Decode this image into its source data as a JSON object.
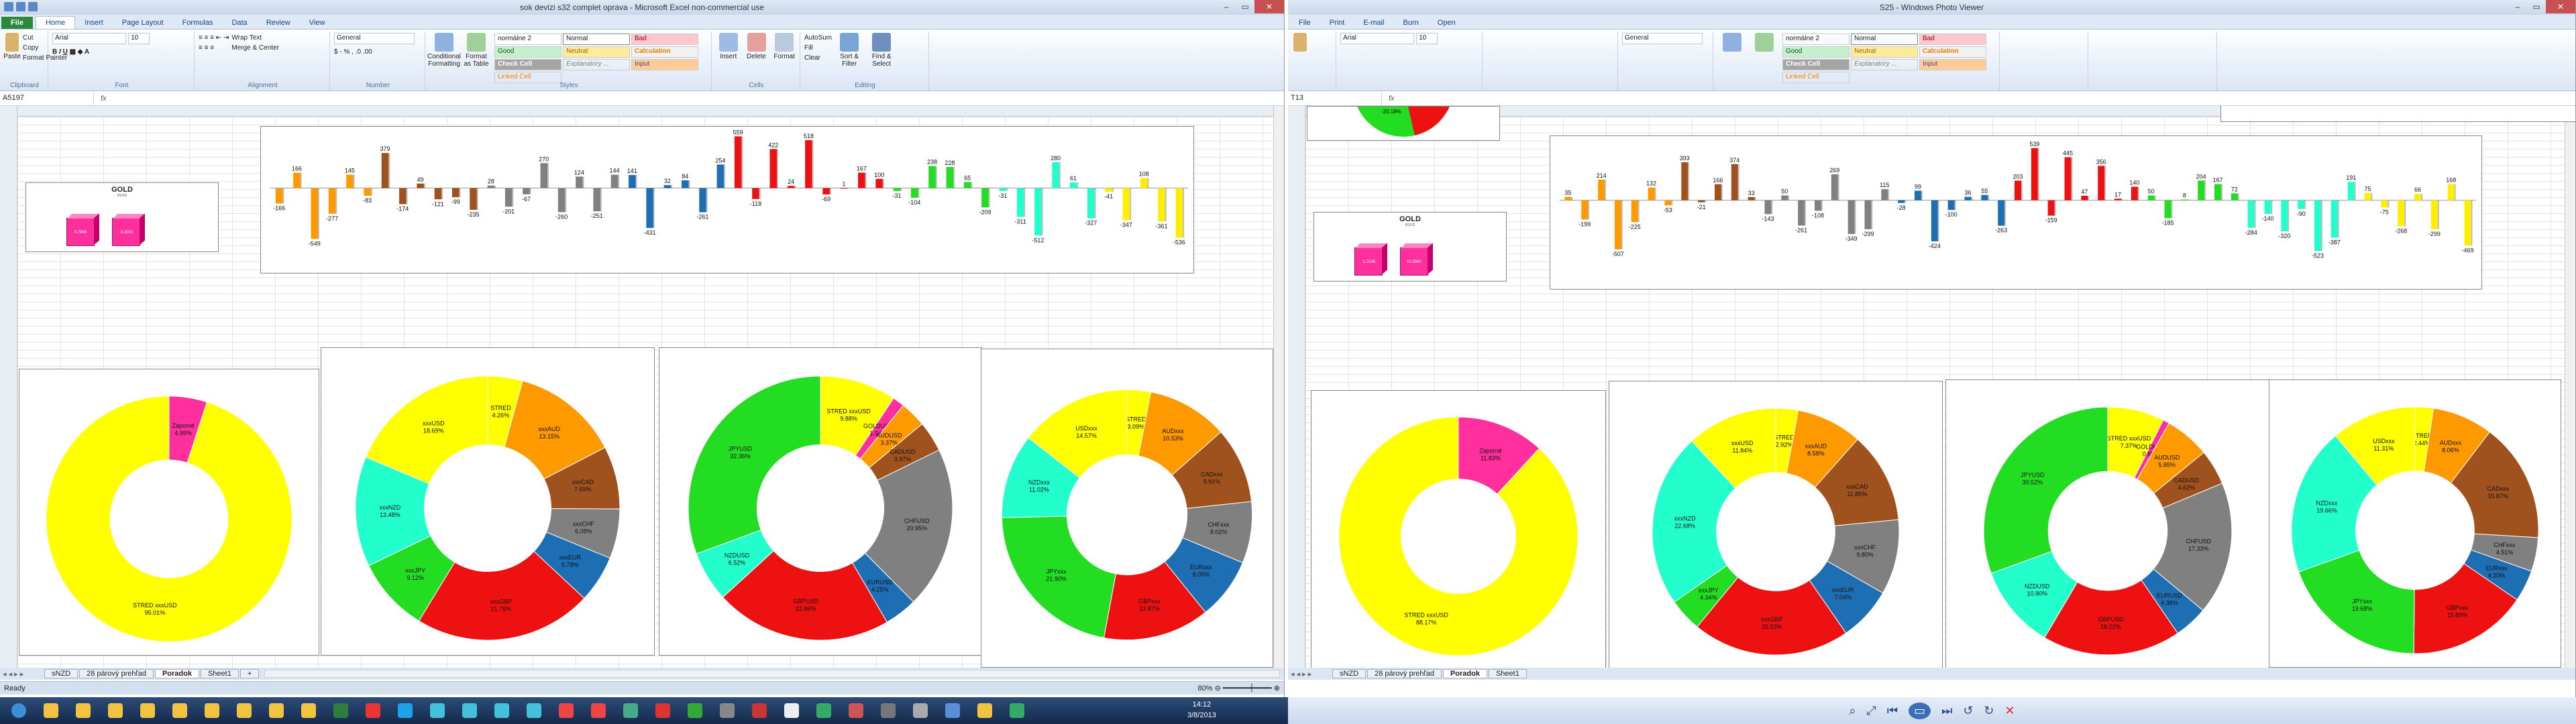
{
  "left": {
    "title": "sok devizi s32 complet oprava - Microsoft Excel non-commercial use",
    "tabs": [
      "File",
      "Home",
      "Insert",
      "Page Layout",
      "Formulas",
      "Data",
      "Review",
      "View"
    ],
    "clipboard": {
      "paste": "Paste",
      "cut": "Cut",
      "copy": "Copy",
      "format_painter": "Format Painter",
      "label": "Clipboard"
    },
    "font": {
      "name": "Arial",
      "size": "10",
      "label": "Font"
    },
    "alignment": {
      "wrap": "Wrap Text",
      "merge": "Merge & Center",
      "label": "Alignment"
    },
    "number": {
      "format": "General",
      "label": "Number"
    },
    "styles": {
      "cond": "Conditional Formatting",
      "table": "Format as Table",
      "label": "Styles",
      "boxes": [
        "normálne 2",
        "Normal",
        "Bad",
        "Good",
        "Neutral",
        "Calculation",
        "Check Cell",
        "Explanatory ...",
        "Input",
        "Linked Cell"
      ]
    },
    "cells": {
      "insert": "Insert",
      "delete": "Delete",
      "format": "Format",
      "label": "Cells"
    },
    "editing": {
      "autosum": "AutoSum",
      "fill": "Fill",
      "clear": "Clear",
      "sort": "Sort & Filter",
      "find": "Find & Select",
      "label": "Editing"
    },
    "namebox": "A5197",
    "sheets": [
      "sNZD",
      "28 párový prehľad",
      "Poradok",
      "Sheet1"
    ],
    "active_sheet": "Poradok",
    "status": "Ready",
    "zoom": "80%",
    "gold": {
      "title": "GOLD",
      "sub": "RSI1D",
      "values": [
        "0.7966",
        "-0.3003"
      ]
    },
    "bars": {
      "values": [
        -166,
        166,
        -549,
        -277,
        145,
        -83,
        379,
        -174,
        49,
        -121,
        -99,
        -235,
        28,
        -201,
        -67,
        270,
        -260,
        124,
        -251,
        144,
        141,
        -431,
        32,
        84,
        -261,
        254,
        559,
        -118,
        422,
        24,
        518,
        -69,
        1,
        167,
        100,
        -31,
        -104,
        238,
        228,
        65,
        -209,
        -31,
        -311,
        -512,
        280,
        61,
        -327,
        -41,
        -347,
        108,
        -361,
        -536
      ],
      "colors": [
        "#ff9900",
        "#ff9900",
        "#ff9900",
        "#ff9900",
        "#ff9900",
        "#ff9900",
        "#a0521e",
        "#a0521e",
        "#a0521e",
        "#a0521e",
        "#a0521e",
        "#a0521e",
        "#808080",
        "#808080",
        "#808080",
        "#808080",
        "#808080",
        "#808080",
        "#808080",
        "#808080",
        "#1e6eb4",
        "#1e6eb4",
        "#1e6eb4",
        "#1e6eb4",
        "#1e6eb4",
        "#1e6eb4",
        "#ee1111",
        "#ee1111",
        "#ee1111",
        "#ee1111",
        "#ee1111",
        "#ee1111",
        "#ee1111",
        "#ee1111",
        "#ee1111",
        "#22dd22",
        "#22dd22",
        "#22dd22",
        "#22dd22",
        "#22dd22",
        "#22dd22",
        "#22ffcc",
        "#22ffcc",
        "#22ffcc",
        "#22ffcc",
        "#22ffcc",
        "#22ffcc",
        "#ffee00",
        "#ffee00",
        "#ffee00",
        "#ffee00",
        "#ffee00"
      ]
    },
    "donuts": [
      {
        "slices": [
          {
            "label": "Záporné",
            "pct": "4.99%",
            "v": 4.99,
            "c": "#ff2f9d"
          },
          {
            "label": "STRED xxxUSD",
            "pct": "95.01%",
            "v": 95.01,
            "c": "#ffff00"
          }
        ]
      },
      {
        "slices": [
          {
            "label": "STRED",
            "pct": "4.26%",
            "v": 4.26,
            "c": "#ffff00"
          },
          {
            "label": "xxxAUD",
            "pct": "13.15%",
            "v": 13.15,
            "c": "#ff9900"
          },
          {
            "label": "xxxCAD",
            "pct": "7.69%",
            "v": 7.69,
            "c": "#a0521e"
          },
          {
            "label": "xxxCHF",
            "pct": "6.08%",
            "v": 6.08,
            "c": "#808080"
          },
          {
            "label": "xxxEUR",
            "pct": "5.78%",
            "v": 5.78,
            "c": "#1e6eb4"
          },
          {
            "label": "xxxGBP",
            "pct": "21.75%",
            "v": 21.75,
            "c": "#ee1111"
          },
          {
            "label": "xxxJPY",
            "pct": "9.12%",
            "v": 9.12,
            "c": "#22dd22"
          },
          {
            "label": "xxxNZD",
            "pct": "13.48%",
            "v": 13.48,
            "c": "#22ffcc"
          },
          {
            "label": "xxxUSD",
            "pct": "18.69%",
            "v": 18.69,
            "c": "#ffff00"
          }
        ]
      },
      {
        "slices": [
          {
            "label": "STRED xxxUSD",
            "pct": "9.88%",
            "v": 9.88,
            "c": "#ffff00"
          },
          {
            "label": "GOLDUSD",
            "pct": "1.54%",
            "v": 1.54,
            "c": "#ff2f9d"
          },
          {
            "label": "AUDUSD",
            "pct": "3.37%",
            "v": 3.37,
            "c": "#ff9900"
          },
          {
            "label": "CADUSD",
            "pct": "3.97%",
            "v": 3.97,
            "c": "#a0521e"
          },
          {
            "label": "CHFUSD",
            "pct": "20.95%",
            "v": 20.95,
            "c": "#808080"
          },
          {
            "label": "EURUSD",
            "pct": "4.25%",
            "v": 4.25,
            "c": "#1e6eb4"
          },
          {
            "label": "GBPUSD",
            "pct": "22.86%",
            "v": 22.86,
            "c": "#ee1111"
          },
          {
            "label": "NZDUSD",
            "pct": "6.52%",
            "v": 6.52,
            "c": "#22ffcc"
          },
          {
            "label": "JPYUSD",
            "pct": "32.36%",
            "v": 32.36,
            "c": "#22dd22"
          }
        ]
      },
      {
        "slices": [
          {
            "label": "STRED",
            "pct": "3.09%",
            "v": 3.09,
            "c": "#ffff00"
          },
          {
            "label": "AUDxxx",
            "pct": "10.53%",
            "v": 10.53,
            "c": "#ff9900"
          },
          {
            "label": "CADxxx",
            "pct": "9.91%",
            "v": 9.91,
            "c": "#a0521e"
          },
          {
            "label": "CHFxxx",
            "pct": "8.02%",
            "v": 8.02,
            "c": "#808080"
          },
          {
            "label": "EURxxx",
            "pct": "8.05%",
            "v": 8.05,
            "c": "#1e6eb4"
          },
          {
            "label": "GBPxxx",
            "pct": "13.87%",
            "v": 13.87,
            "c": "#ee1111"
          },
          {
            "label": "JPYxxx",
            "pct": "21.90%",
            "v": 21.9,
            "c": "#22dd22"
          },
          {
            "label": "NZDxxx",
            "pct": "11.02%",
            "v": 11.02,
            "c": "#22ffcc"
          },
          {
            "label": "USDxxx",
            "pct": "14.57%",
            "v": 14.57,
            "c": "#ffff00"
          }
        ]
      }
    ]
  },
  "right": {
    "title": "S25 - Windows Photo Viewer",
    "menu": [
      "File",
      "Print",
      "E-mail",
      "Burn",
      "Open"
    ],
    "namebox": "T13",
    "font": {
      "name": "Arial",
      "size": "10"
    },
    "number": {
      "format": "General"
    },
    "styles": {
      "boxes": [
        "normálne 2",
        "Normal",
        "Bad",
        "Good",
        "Neutral",
        "Calculation",
        "Check Cell",
        "Explanatory ...",
        "Input",
        "Linked Cell"
      ]
    },
    "sheets": [
      "sNZD",
      "28 párový prehľad",
      "Poradok",
      "Sheet1"
    ],
    "active_sheet": "Poradok",
    "top_pie_label": "-20.18%",
    "gold": {
      "title": "GOLD",
      "sub": "RSI1D",
      "values": [
        "-1.2166",
        "10.5960"
      ]
    },
    "bars": {
      "values": [
        35,
        -199,
        214,
        -507,
        -225,
        132,
        -53,
        393,
        -21,
        166,
        374,
        33,
        -143,
        50,
        -261,
        -108,
        269,
        -349,
        -299,
        115,
        -28,
        99,
        -424,
        -100,
        36,
        55,
        -263,
        203,
        539,
        -159,
        445,
        47,
        356,
        17,
        140,
        50,
        -185,
        8,
        204,
        167,
        72,
        -284,
        -140,
        -320,
        -90,
        -523,
        -387,
        191,
        75,
        -75,
        -268,
        66,
        -299,
        168,
        -469
      ],
      "colors": [
        "#ff9900",
        "#ff9900",
        "#ff9900",
        "#ff9900",
        "#ff9900",
        "#ff9900",
        "#ff9900",
        "#a0521e",
        "#a0521e",
        "#a0521e",
        "#a0521e",
        "#a0521e",
        "#808080",
        "#808080",
        "#808080",
        "#808080",
        "#808080",
        "#808080",
        "#808080",
        "#808080",
        "#1e6eb4",
        "#1e6eb4",
        "#1e6eb4",
        "#1e6eb4",
        "#1e6eb4",
        "#1e6eb4",
        "#1e6eb4",
        "#ee1111",
        "#ee1111",
        "#ee1111",
        "#ee1111",
        "#ee1111",
        "#ee1111",
        "#ee1111",
        "#ee1111",
        "#22dd22",
        "#22dd22",
        "#22dd22",
        "#22dd22",
        "#22dd22",
        "#22dd22",
        "#22ffcc",
        "#22ffcc",
        "#22ffcc",
        "#22ffcc",
        "#22ffcc",
        "#22ffcc",
        "#22ffcc",
        "#ffee00",
        "#ffee00",
        "#ffee00",
        "#ffee00",
        "#ffee00",
        "#ffee00",
        "#ffee00"
      ]
    },
    "donuts": [
      {
        "slices": [
          {
            "label": "Záporné",
            "pct": "11.83%",
            "v": 11.83,
            "c": "#ff2f9d"
          },
          {
            "label": "STRED xxxUSD",
            "pct": "88.17%",
            "v": 88.17,
            "c": "#ffff00"
          }
        ]
      },
      {
        "slices": [
          {
            "label": "STRED",
            "pct": "2.92%",
            "v": 2.92,
            "c": "#ffff00"
          },
          {
            "label": "xxxAUD",
            "pct": "8.58%",
            "v": 8.58,
            "c": "#ff9900"
          },
          {
            "label": "xxxCAD",
            "pct": "11.85%",
            "v": 11.85,
            "c": "#a0521e"
          },
          {
            "label": "xxxCHF",
            "pct": "9.80%",
            "v": 9.8,
            "c": "#808080"
          },
          {
            "label": "xxxEUR",
            "pct": "7.04%",
            "v": 7.04,
            "c": "#1e6eb4"
          },
          {
            "label": "xxxGBP",
            "pct": "20.53%",
            "v": 20.53,
            "c": "#ee1111"
          },
          {
            "label": "xxxJPY",
            "pct": "4.34%",
            "v": 4.34,
            "c": "#22dd22"
          },
          {
            "label": "xxxNZD",
            "pct": "22.68%",
            "v": 22.68,
            "c": "#22ffcc"
          },
          {
            "label": "xxxUSD",
            "pct": "11.84%",
            "v": 11.84,
            "c": "#ffff00"
          }
        ]
      },
      {
        "slices": [
          {
            "label": "STRED xxxUSD",
            "pct": "7.37%",
            "v": 7.37,
            "c": "#ffff00"
          },
          {
            "label": "GOLDUSD",
            "pct": "0.85%",
            "v": 0.85,
            "c": "#ff2f9d"
          },
          {
            "label": "AUDUSD",
            "pct": "5.85%",
            "v": 5.85,
            "c": "#ff9900"
          },
          {
            "label": "CADUSD",
            "pct": "4.62%",
            "v": 4.62,
            "c": "#a0521e"
          },
          {
            "label": "CHFUSD",
            "pct": "17.33%",
            "v": 17.33,
            "c": "#808080"
          },
          {
            "label": "EURUSD",
            "pct": "4.38%",
            "v": 4.38,
            "c": "#1e6eb4"
          },
          {
            "label": "GBPUSD",
            "pct": "18.02%",
            "v": 18.02,
            "c": "#ee1111"
          },
          {
            "label": "NZDUSD",
            "pct": "10.90%",
            "v": 10.9,
            "c": "#22ffcc"
          },
          {
            "label": "JPYUSD",
            "pct": "30.52%",
            "v": 30.52,
            "c": "#22dd22"
          }
        ]
      },
      {
        "slices": [
          {
            "label": "STRED",
            "pct": "2.44%",
            "v": 2.44,
            "c": "#ffff00"
          },
          {
            "label": "AUDxxx",
            "pct": "8.06%",
            "v": 8.06,
            "c": "#ff9900"
          },
          {
            "label": "CADxxx",
            "pct": "15.87%",
            "v": 15.87,
            "c": "#a0521e"
          },
          {
            "label": "CHFxxx",
            "pct": "4.51%",
            "v": 4.51,
            "c": "#808080"
          },
          {
            "label": "EURxxx",
            "pct": "4.20%",
            "v": 4.2,
            "c": "#1e6eb4"
          },
          {
            "label": "GBPxxx",
            "pct": "15.89%",
            "v": 15.89,
            "c": "#ee1111"
          },
          {
            "label": "JPYxxx",
            "pct": "19.68%",
            "v": 19.68,
            "c": "#22dd22"
          },
          {
            "label": "NZDxxx",
            "pct": "19.66%",
            "v": 19.66,
            "c": "#22ffcc"
          },
          {
            "label": "USDxxx",
            "pct": "11.31%",
            "v": 11.31,
            "c": "#ffff00"
          }
        ]
      }
    ]
  },
  "taskbar": {
    "time": "14:12",
    "date": "3/8/2013",
    "icons": [
      "#3b8fd6",
      "#f2c341",
      "#f2c341",
      "#f2c341",
      "#f2c341",
      "#f2c341",
      "#f2c341",
      "#f2c341",
      "#f2c341",
      "#f2c341",
      "#2f7d3e",
      "#e33",
      "#1aa3e8",
      "#44c0d8",
      "#44c0d8",
      "#44c0d8",
      "#44c0d8",
      "#e44",
      "#e44",
      "#4a8",
      "#d33",
      "#3a3",
      "#888",
      "#c33",
      "#eee",
      "#3a6",
      "#c55",
      "#777",
      "#aaa",
      "#5a8fd6",
      "#f2c341",
      "#3a6"
    ]
  },
  "photoviewer": {
    "controls": [
      "zoom",
      "actual-size",
      "prev",
      "slideshow",
      "next",
      "rotate-ccw",
      "rotate-cw",
      "delete"
    ]
  }
}
